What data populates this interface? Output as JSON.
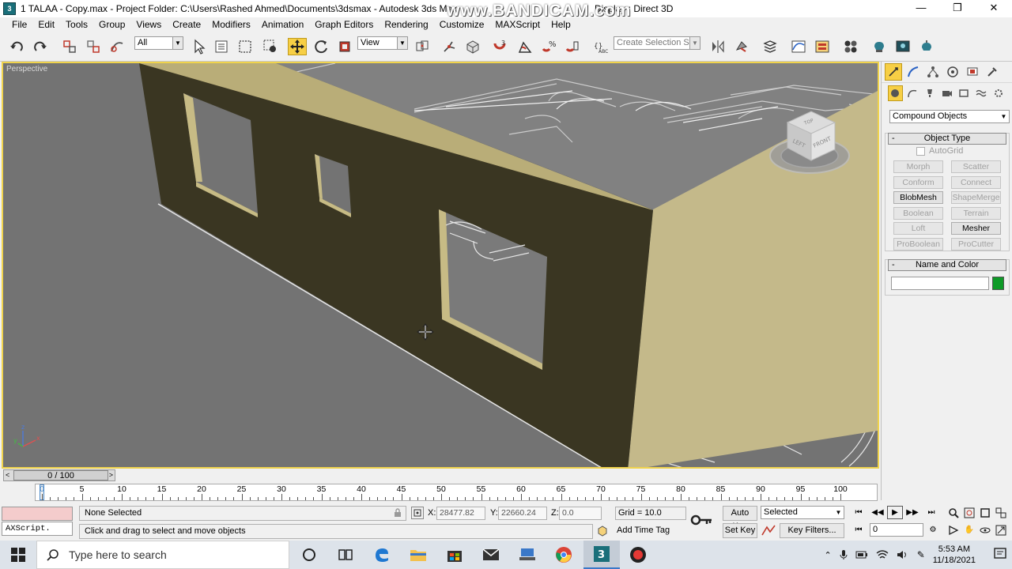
{
  "window": {
    "title": "1 TALAA - Copy.max     - Project Folder: C:\\Users\\Rashed Ahmed\\Documents\\3dsmax     - Autodesk 3ds Max",
    "title_tail": "Display : Direct 3D",
    "watermark": "www.BANDICAM.com",
    "controls": {
      "minimize": "—",
      "maximize": "❐",
      "close": "✕"
    }
  },
  "menu": [
    "File",
    "Edit",
    "Tools",
    "Group",
    "Views",
    "Create",
    "Modifiers",
    "Animation",
    "Graph Editors",
    "Rendering",
    "Customize",
    "MAXScript",
    "Help"
  ],
  "toolbar": {
    "filter_value": "All",
    "coord_system": "View",
    "selection_set_placeholder": "Create Selection Set"
  },
  "viewport": {
    "label": "Perspective",
    "viewcube": {
      "top": "TOP",
      "left": "LEFT",
      "front": "FRONT"
    },
    "axis": {
      "x": "x",
      "y": "y",
      "z": "z"
    }
  },
  "command_panel": {
    "category": "Compound Objects",
    "object_type_title": "Object Type",
    "autogrid": "AutoGrid",
    "buttons": [
      {
        "label": "Morph",
        "enabled": false
      },
      {
        "label": "Scatter",
        "enabled": false
      },
      {
        "label": "Conform",
        "enabled": false
      },
      {
        "label": "Connect",
        "enabled": false
      },
      {
        "label": "BlobMesh",
        "enabled": true
      },
      {
        "label": "ShapeMerge",
        "enabled": false
      },
      {
        "label": "Boolean",
        "enabled": false
      },
      {
        "label": "Terrain",
        "enabled": false
      },
      {
        "label": "Loft",
        "enabled": false
      },
      {
        "label": "Mesher",
        "enabled": true
      },
      {
        "label": "ProBoolean",
        "enabled": false
      },
      {
        "label": "ProCutter",
        "enabled": false
      }
    ],
    "name_color_title": "Name and Color",
    "name_value": "",
    "object_color": "#0e9a27"
  },
  "timeline": {
    "slider_label": "0 / 100",
    "ticks": [
      "0",
      "5",
      "10",
      "15",
      "20",
      "25",
      "30",
      "35",
      "40",
      "45",
      "50",
      "55",
      "60",
      "65",
      "70",
      "75",
      "80",
      "85",
      "90",
      "95",
      "100"
    ]
  },
  "status": {
    "maxscript_label": "AXScript.",
    "selection": "None Selected",
    "prompt": "Click and drag to select and move objects",
    "x_label": "X:",
    "x_value": "28477.82",
    "y_label": "Y:",
    "y_value": "22660.24",
    "z_label": "Z:",
    "z_value": "0.0",
    "grid": "Grid = 10.0",
    "add_time_tag": "Add Time Tag",
    "auto_key": "Auto Key",
    "set_key": "Set Key",
    "key_mode": "Selected",
    "key_filters": "Key Filters...",
    "current_frame": "0"
  },
  "taskbar": {
    "search_placeholder": "Type here to search",
    "time": "5:53 AM",
    "date": "11/18/2021"
  },
  "colors": {
    "viewport_bg": "#737373",
    "wall_dark": "#3a3622",
    "wall_light": "#c4b98a",
    "active_yellow": "#f7cf45"
  }
}
